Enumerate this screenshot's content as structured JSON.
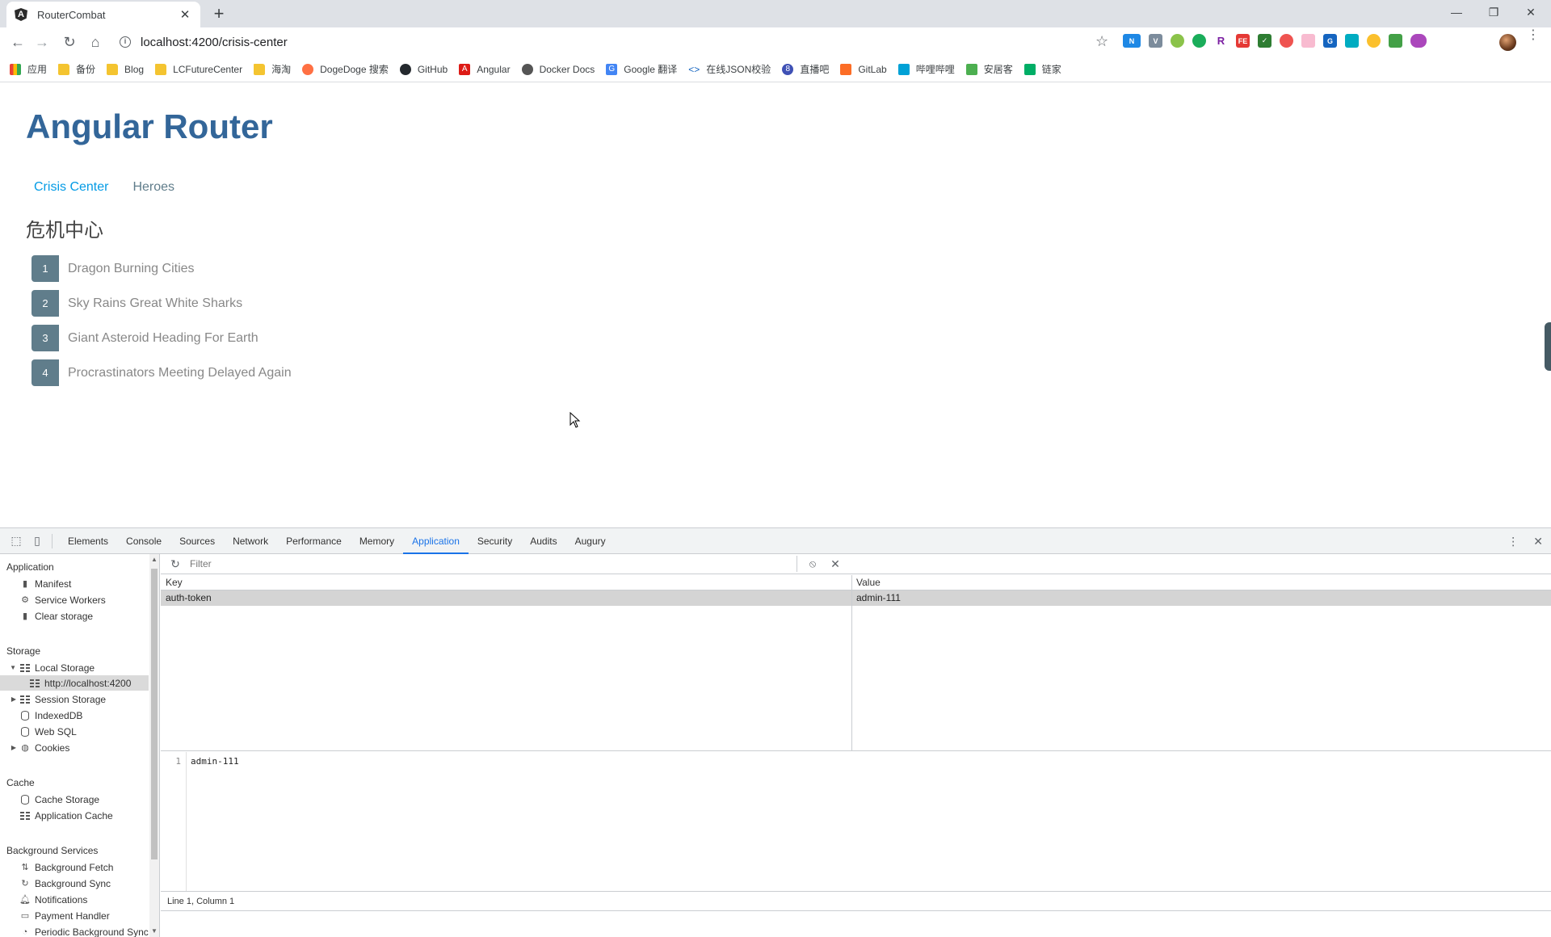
{
  "browser": {
    "tab_title": "RouterCombat",
    "tab_close": "✕",
    "new_tab": "+",
    "url": "localhost:4200/crisis-center",
    "bookmarks": [
      "应用",
      "备份",
      "Blog",
      "LCFutureCenter",
      "海淘",
      "DogeDoge 搜索",
      "GitHub",
      "Angular",
      "Docker Docs",
      "Google 翻译",
      "在线JSON校验",
      "直播吧",
      "GitLab",
      "哔哩哔哩",
      "安居客",
      "链家"
    ]
  },
  "app": {
    "title": "Angular Router",
    "nav": [
      "Crisis Center",
      "Heroes"
    ],
    "section_title": "危机中心",
    "crises": [
      {
        "id": "1",
        "name": "Dragon Burning Cities"
      },
      {
        "id": "2",
        "name": "Sky Rains Great White Sharks"
      },
      {
        "id": "3",
        "name": "Giant Asteroid Heading For Earth"
      },
      {
        "id": "4",
        "name": "Procrastinators Meeting Delayed Again"
      }
    ]
  },
  "devtools": {
    "tabs": [
      "Elements",
      "Console",
      "Sources",
      "Network",
      "Performance",
      "Memory",
      "Application",
      "Security",
      "Audits",
      "Augury"
    ],
    "active_tab": "Application",
    "sidebar": {
      "application_header": "Application",
      "application_items": [
        "Manifest",
        "Service Workers",
        "Clear storage"
      ],
      "storage_header": "Storage",
      "local_storage": "Local Storage",
      "local_storage_origin": "http://localhost:4200",
      "storage_items": [
        "Session Storage",
        "IndexedDB",
        "Web SQL",
        "Cookies"
      ],
      "cache_header": "Cache",
      "cache_items": [
        "Cache Storage",
        "Application Cache"
      ],
      "bg_header": "Background Services",
      "bg_items": [
        "Background Fetch",
        "Background Sync",
        "Notifications",
        "Payment Handler",
        "Periodic Background Sync"
      ]
    },
    "filter_placeholder": "Filter",
    "table": {
      "key_header": "Key",
      "value_header": "Value",
      "rows": [
        {
          "key": "auth-token",
          "value": "admin-111"
        }
      ]
    },
    "editor": {
      "line_number": "1",
      "content": "admin-111",
      "status": "Line 1, Column 1"
    }
  },
  "colors": {
    "title": "#336699",
    "nav_active": "#039be5",
    "badge": "#607d8b",
    "devtools_active": "#1a73e8"
  }
}
